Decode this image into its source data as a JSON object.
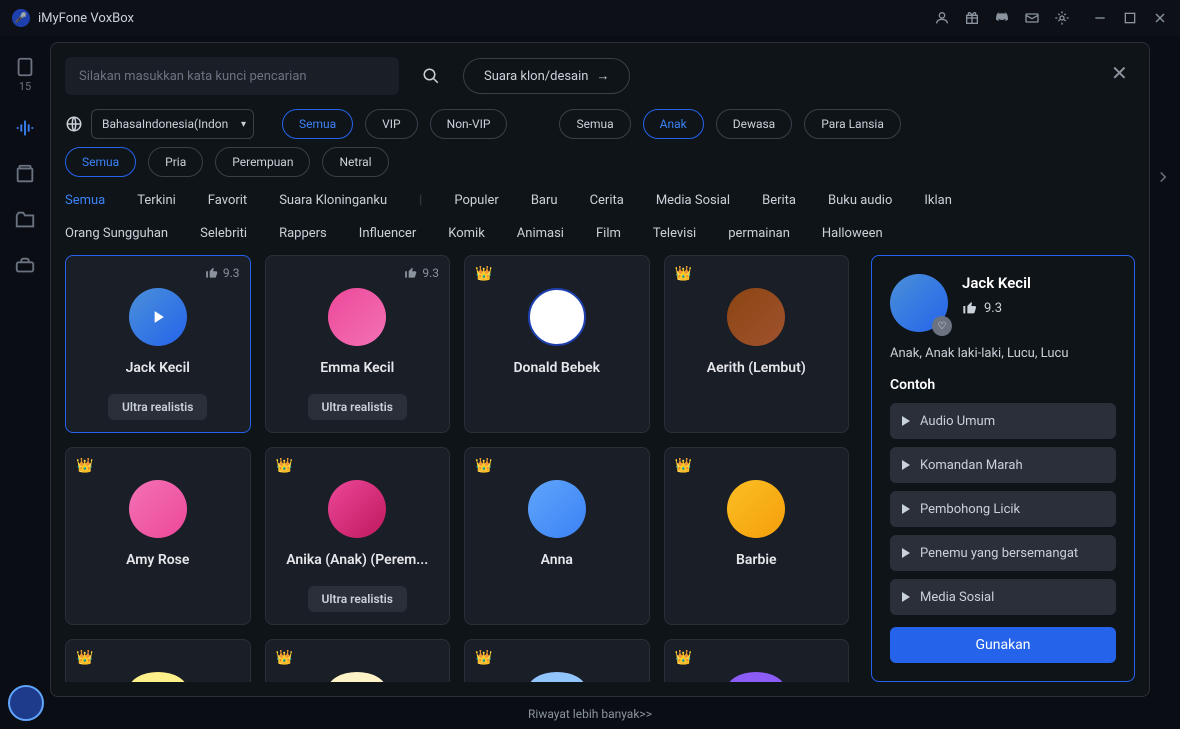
{
  "app": {
    "title": "iMyFone VoxBox"
  },
  "sidebar_num": "15",
  "search": {
    "placeholder": "Silakan masukkan kata kunci pencarian"
  },
  "clone_btn": "Suara klon/desain",
  "language": "BahasaIndonesia(Indon",
  "vip_pills": [
    {
      "label": "Semua",
      "active": true
    },
    {
      "label": "VIP",
      "active": false
    },
    {
      "label": "Non-VIP",
      "active": false
    }
  ],
  "age_pills": [
    {
      "label": "Semua",
      "active": false
    },
    {
      "label": "Anak",
      "active": true
    },
    {
      "label": "Dewasa",
      "active": false
    },
    {
      "label": "Para Lansia",
      "active": false
    }
  ],
  "gender_pills": [
    {
      "label": "Semua",
      "active": true
    },
    {
      "label": "Pria",
      "active": false
    },
    {
      "label": "Perempuan",
      "active": false
    },
    {
      "label": "Netral",
      "active": false
    }
  ],
  "categories_row1": [
    {
      "label": "Semua",
      "active": true
    },
    {
      "label": "Terkini"
    },
    {
      "label": "Favorit"
    },
    {
      "label": "Suara Kloninganku"
    }
  ],
  "categories_row2": [
    {
      "label": "Populer"
    },
    {
      "label": "Baru"
    },
    {
      "label": "Cerita"
    },
    {
      "label": "Media Sosial"
    },
    {
      "label": "Berita"
    },
    {
      "label": "Buku audio"
    },
    {
      "label": "Iklan"
    }
  ],
  "categories_row3": [
    {
      "label": "Orang Sungguhan"
    },
    {
      "label": "Selebriti"
    },
    {
      "label": "Rappers"
    },
    {
      "label": "Influencer"
    },
    {
      "label": "Komik"
    },
    {
      "label": "Animasi"
    },
    {
      "label": "Film"
    },
    {
      "label": "Televisi"
    },
    {
      "label": "permainan"
    },
    {
      "label": "Halloween"
    }
  ],
  "voices": [
    {
      "name": "Jack Kecil",
      "rating": "9.3",
      "ultra": "Ultra realistis",
      "crown": false,
      "selected": true,
      "play": true,
      "av": "av1"
    },
    {
      "name": "Emma Kecil",
      "rating": "9.3",
      "ultra": "Ultra realistis",
      "crown": false,
      "av": "av2"
    },
    {
      "name": "Donald Bebek",
      "crown": true,
      "av": "av3"
    },
    {
      "name": "Aerith (Lembut)",
      "crown": true,
      "av": "av4"
    },
    {
      "name": "Amy Rose",
      "crown": true,
      "av": "av5"
    },
    {
      "name": "Anika (Anak) (Perem...",
      "crown": true,
      "ultra": "Ultra realistis",
      "av": "av6"
    },
    {
      "name": "Anna",
      "crown": true,
      "av": "av7"
    },
    {
      "name": "Barbie",
      "crown": true,
      "av": "av8"
    },
    {
      "name": "",
      "crown": true,
      "av": "av9",
      "partial": true
    },
    {
      "name": "",
      "crown": true,
      "av": "av10",
      "partial": true
    },
    {
      "name": "",
      "crown": true,
      "av": "av11",
      "partial": true
    },
    {
      "name": "",
      "crown": true,
      "av": "av12",
      "partial": true
    }
  ],
  "detail": {
    "name": "Jack Kecil",
    "rating": "9.3",
    "tags": "Anak, Anak laki-laki, Lucu, Lucu",
    "section": "Contoh",
    "samples": [
      "Audio Umum",
      "Komandan Marah",
      "Pembohong Licik",
      "Penemu yang bersemangat",
      "Media Sosial"
    ],
    "use_btn": "Gunakan"
  },
  "history_link": "Riwayat lebih banyak>>"
}
